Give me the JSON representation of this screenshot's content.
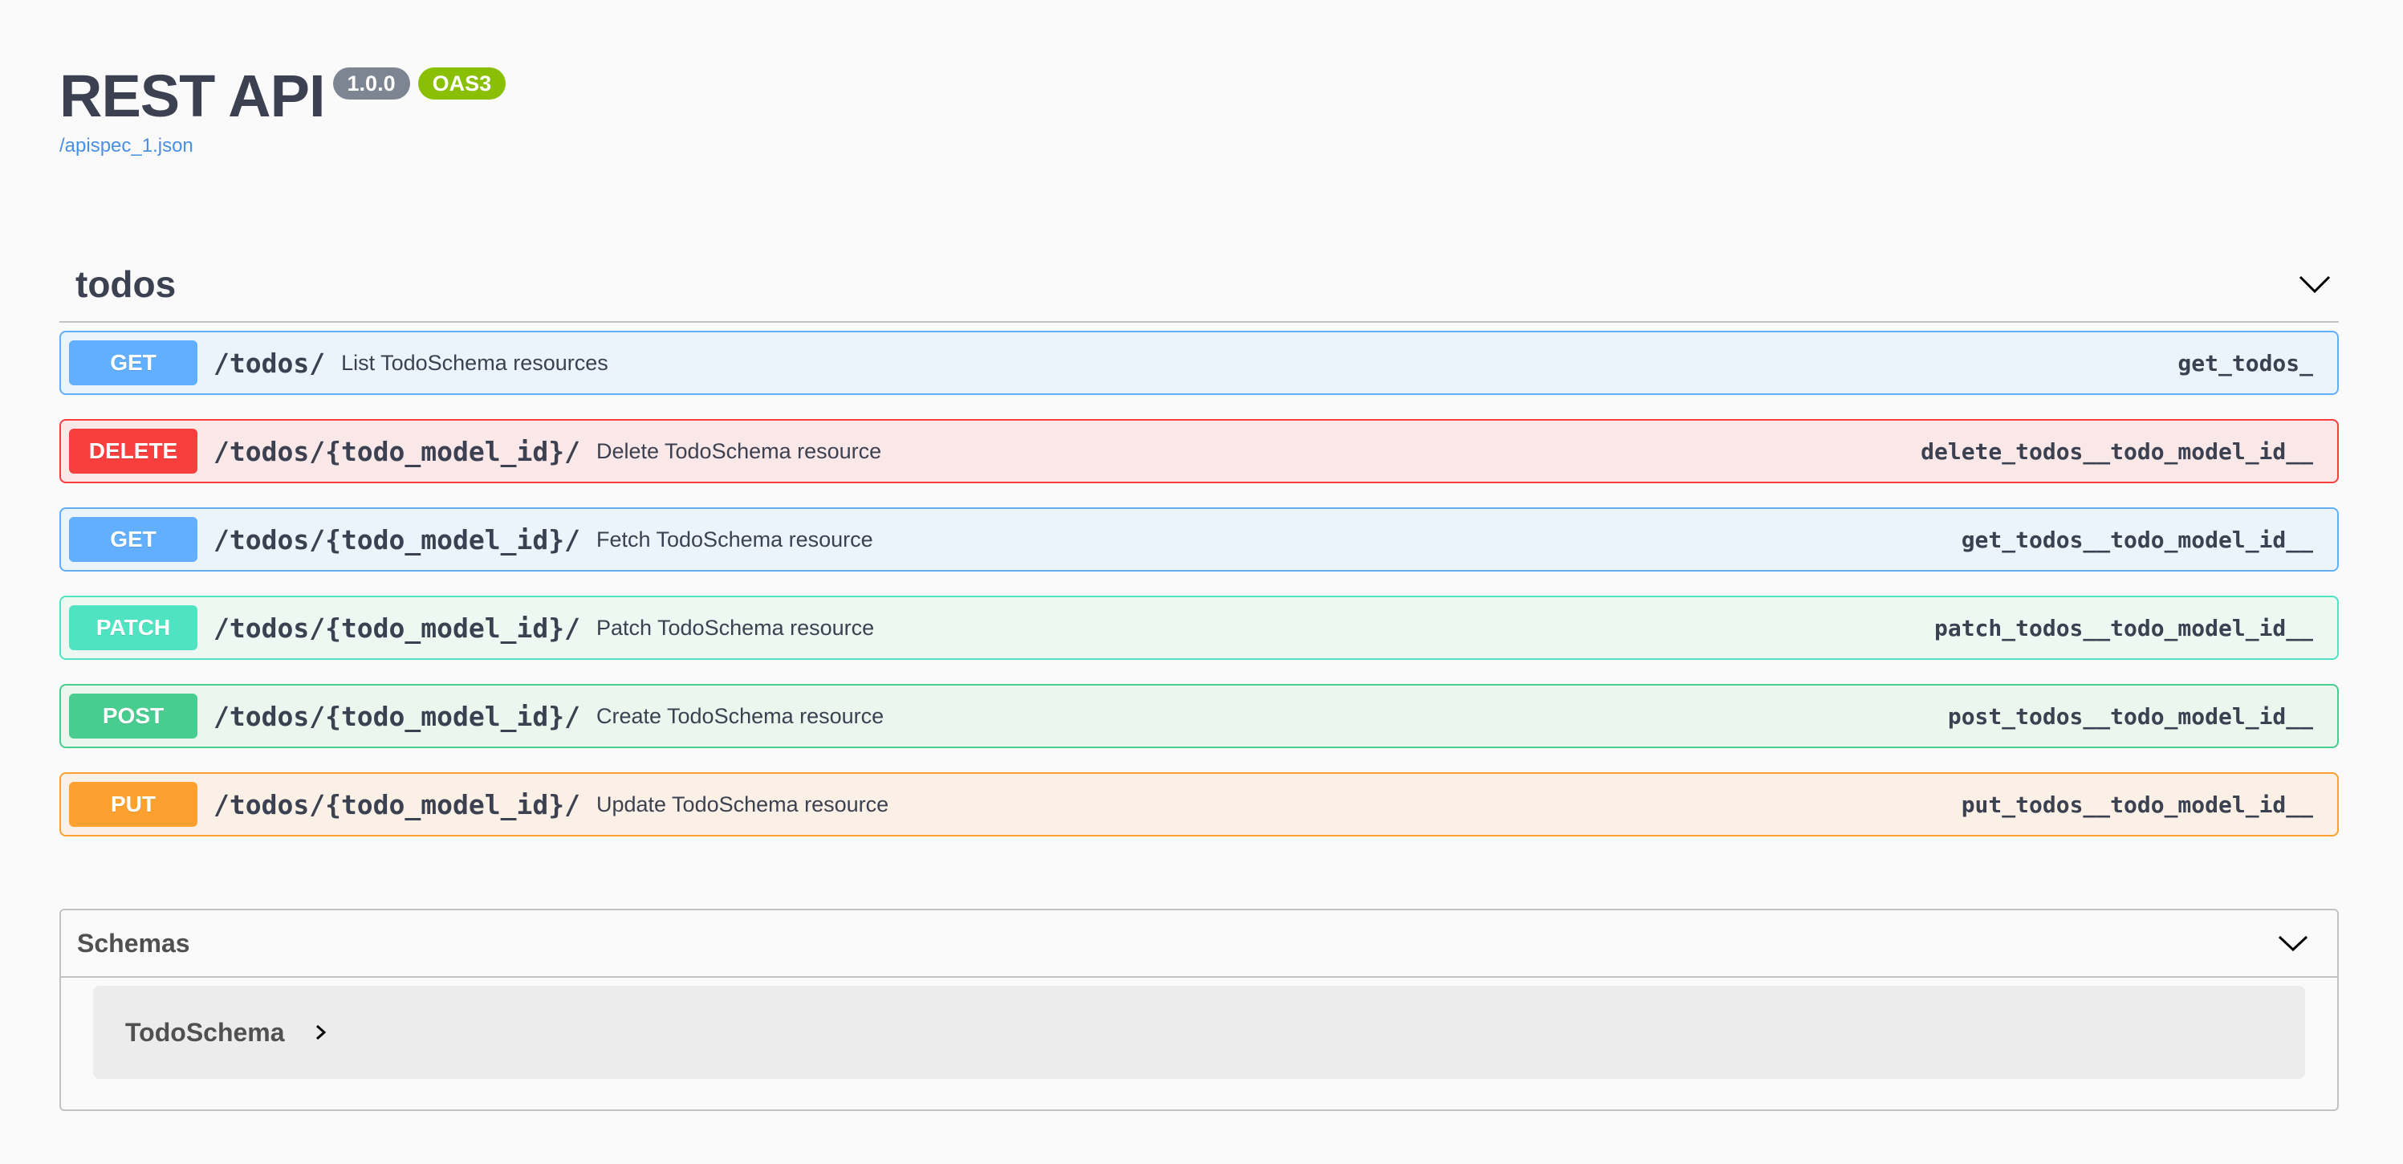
{
  "info": {
    "title": "REST API",
    "version": "1.0.0",
    "oas": "OAS3",
    "spec_link": "/apispec_1.json"
  },
  "tag": {
    "name": "todos",
    "chevron_icon": "chevron-down-icon"
  },
  "operations": [
    {
      "method": "GET",
      "path": "/todos/",
      "summary": "List TodoSchema resources",
      "operation_id": "get_todos_"
    },
    {
      "method": "DELETE",
      "path": "/todos/{todo_model_id}/",
      "summary": "Delete TodoSchema resource",
      "operation_id": "delete_todos__todo_model_id__"
    },
    {
      "method": "GET",
      "path": "/todos/{todo_model_id}/",
      "summary": "Fetch TodoSchema resource",
      "operation_id": "get_todos__todo_model_id__"
    },
    {
      "method": "PATCH",
      "path": "/todos/{todo_model_id}/",
      "summary": "Patch TodoSchema resource",
      "operation_id": "patch_todos__todo_model_id__"
    },
    {
      "method": "POST",
      "path": "/todos/{todo_model_id}/",
      "summary": "Create TodoSchema resource",
      "operation_id": "post_todos__todo_model_id__"
    },
    {
      "method": "PUT",
      "path": "/todos/{todo_model_id}/",
      "summary": "Update TodoSchema resource",
      "operation_id": "put_todos__todo_model_id__"
    }
  ],
  "schemas": {
    "title": "Schemas",
    "items": [
      {
        "name": "TodoSchema",
        "icon": "chevron-right-icon"
      }
    ]
  },
  "colors": {
    "get": "#61affe",
    "delete": "#f93e3e",
    "patch": "#50e3c2",
    "post": "#49cc90",
    "put": "#fca130",
    "version_badge": "#7d8492",
    "oas_badge": "#89bf04",
    "link": "#4990e2"
  }
}
